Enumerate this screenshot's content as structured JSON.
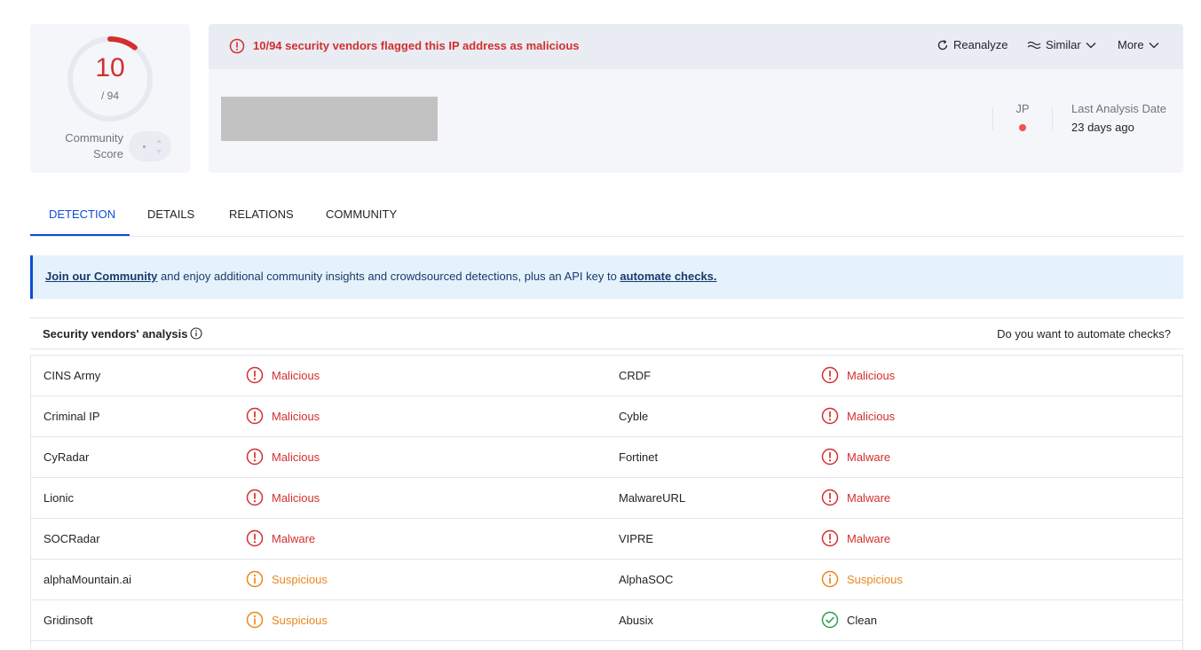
{
  "score": {
    "detected": "10",
    "total": "/ 94",
    "detected_fraction": 0.106,
    "community_label_line1": "Community",
    "community_label_line2": "Score",
    "ring_color": "#d32f2f"
  },
  "header": {
    "alert_text": "10/94 security vendors flagged this IP address as malicious",
    "actions": {
      "reanalyze": "Reanalyze",
      "similar": "Similar",
      "more": "More"
    },
    "country_code": "JP",
    "last_analysis_label": "Last Analysis Date",
    "last_analysis_value": "23 days ago"
  },
  "tabs": [
    {
      "label": "DETECTION",
      "active": true
    },
    {
      "label": "DETAILS",
      "active": false
    },
    {
      "label": "RELATIONS",
      "active": false
    },
    {
      "label": "COMMUNITY",
      "active": false
    }
  ],
  "banner": {
    "link1": "Join our Community",
    "middle": " and enjoy additional community insights and crowdsourced detections, plus an API key to ",
    "link2": "automate checks."
  },
  "vendors": {
    "title": "Security vendors' analysis",
    "automate_prompt": "Do you want to automate checks?",
    "rows": [
      {
        "left_name": "CINS Army",
        "left_result": "Malicious",
        "left_status": "malicious",
        "right_name": "CRDF",
        "right_result": "Malicious",
        "right_status": "malicious"
      },
      {
        "left_name": "Criminal IP",
        "left_result": "Malicious",
        "left_status": "malicious",
        "right_name": "Cyble",
        "right_result": "Malicious",
        "right_status": "malicious"
      },
      {
        "left_name": "CyRadar",
        "left_result": "Malicious",
        "left_status": "malicious",
        "right_name": "Fortinet",
        "right_result": "Malware",
        "right_status": "malicious"
      },
      {
        "left_name": "Lionic",
        "left_result": "Malicious",
        "left_status": "malicious",
        "right_name": "MalwareURL",
        "right_result": "Malware",
        "right_status": "malicious"
      },
      {
        "left_name": "SOCRadar",
        "left_result": "Malware",
        "left_status": "malicious",
        "right_name": "VIPRE",
        "right_result": "Malware",
        "right_status": "malicious"
      },
      {
        "left_name": "alphaMountain.ai",
        "left_result": "Suspicious",
        "left_status": "suspicious",
        "right_name": "AlphaSOC",
        "right_result": "Suspicious",
        "right_status": "suspicious"
      },
      {
        "left_name": "Gridinsoft",
        "left_result": "Suspicious",
        "left_status": "suspicious",
        "right_name": "Abusix",
        "right_result": "Clean",
        "right_status": "clean"
      }
    ]
  },
  "colors": {
    "malicious": "#d32f2f",
    "suspicious": "#e8871e",
    "clean": "#2e9e4f",
    "accent": "#0b4dda"
  }
}
